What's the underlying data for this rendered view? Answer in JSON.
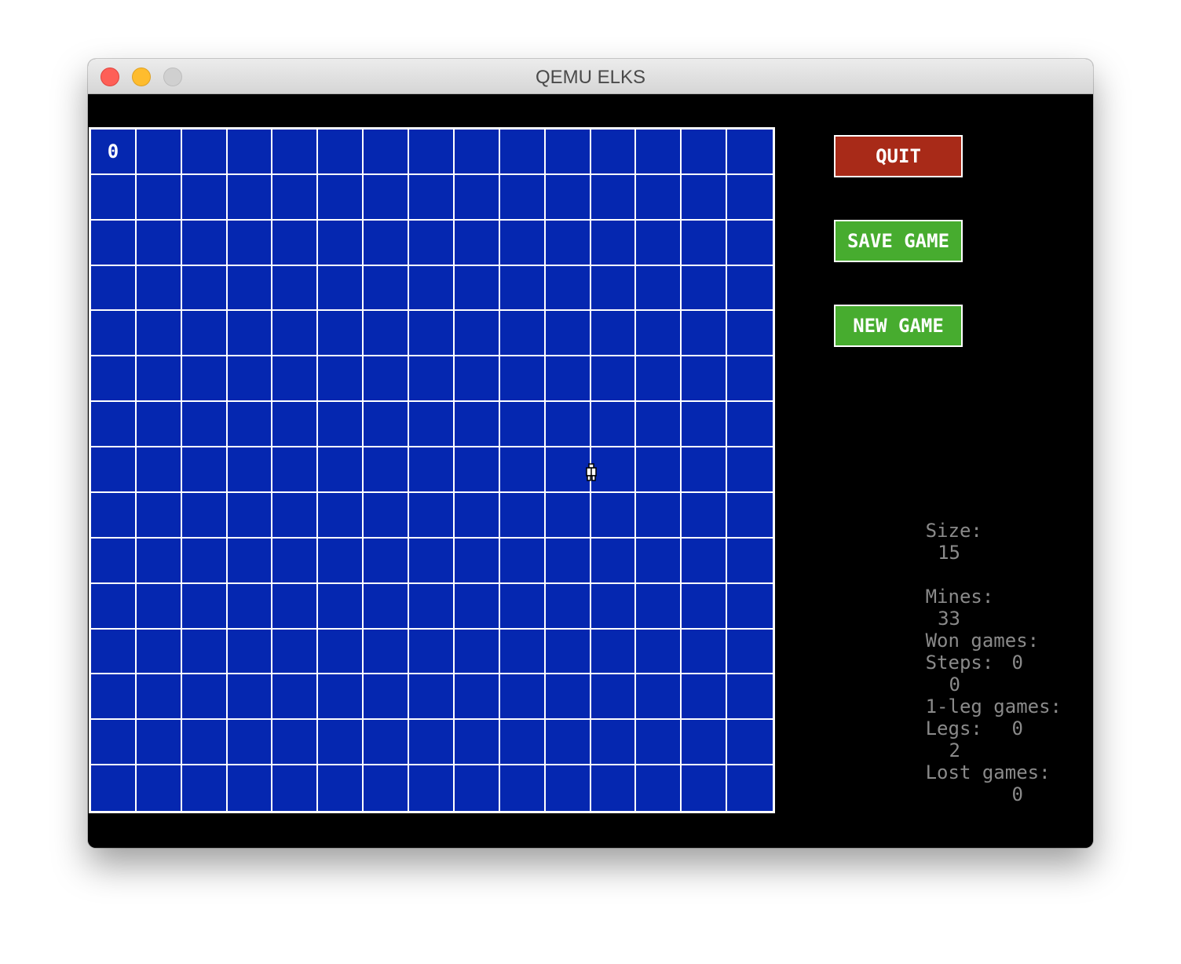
{
  "window": {
    "title": "QEMU ELKS"
  },
  "board": {
    "size": 15,
    "cells": [
      {
        "row": 0,
        "col": 0,
        "text": "0"
      }
    ]
  },
  "buttons": {
    "quit": "QUIT",
    "save_game": "SAVE GAME",
    "new_game": "NEW GAME"
  },
  "game_stats": [
    {
      "label": "Size:",
      "value": "15"
    },
    {
      "label": "Mines:",
      "value": "33"
    },
    {
      "label": "Steps:",
      "value": "0"
    },
    {
      "label": "Legs:",
      "value": "2"
    }
  ],
  "record_stats": [
    {
      "label": "Won games:",
      "value": "0"
    },
    {
      "label": "1-leg games:",
      "value": "0"
    },
    {
      "label": "Lost games:",
      "value": "0"
    }
  ],
  "colors": {
    "board_blue": "#0527b0",
    "grid_white": "#ffffff",
    "quit_red": "#a82a18",
    "action_green": "#47ac2f",
    "stats_gray": "#8a8a8a"
  }
}
